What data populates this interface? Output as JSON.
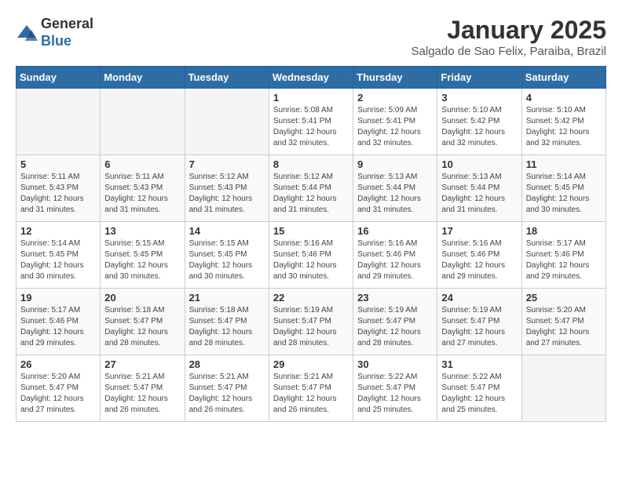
{
  "header": {
    "logo_line1": "General",
    "logo_line2": "Blue",
    "month_year": "January 2025",
    "location": "Salgado de Sao Felix, Paraiba, Brazil"
  },
  "weekdays": [
    "Sunday",
    "Monday",
    "Tuesday",
    "Wednesday",
    "Thursday",
    "Friday",
    "Saturday"
  ],
  "weeks": [
    [
      {
        "day": "",
        "info": ""
      },
      {
        "day": "",
        "info": ""
      },
      {
        "day": "",
        "info": ""
      },
      {
        "day": "1",
        "info": "Sunrise: 5:08 AM\nSunset: 5:41 PM\nDaylight: 12 hours\nand 32 minutes."
      },
      {
        "day": "2",
        "info": "Sunrise: 5:09 AM\nSunset: 5:41 PM\nDaylight: 12 hours\nand 32 minutes."
      },
      {
        "day": "3",
        "info": "Sunrise: 5:10 AM\nSunset: 5:42 PM\nDaylight: 12 hours\nand 32 minutes."
      },
      {
        "day": "4",
        "info": "Sunrise: 5:10 AM\nSunset: 5:42 PM\nDaylight: 12 hours\nand 32 minutes."
      }
    ],
    [
      {
        "day": "5",
        "info": "Sunrise: 5:11 AM\nSunset: 5:43 PM\nDaylight: 12 hours\nand 31 minutes."
      },
      {
        "day": "6",
        "info": "Sunrise: 5:11 AM\nSunset: 5:43 PM\nDaylight: 12 hours\nand 31 minutes."
      },
      {
        "day": "7",
        "info": "Sunrise: 5:12 AM\nSunset: 5:43 PM\nDaylight: 12 hours\nand 31 minutes."
      },
      {
        "day": "8",
        "info": "Sunrise: 5:12 AM\nSunset: 5:44 PM\nDaylight: 12 hours\nand 31 minutes."
      },
      {
        "day": "9",
        "info": "Sunrise: 5:13 AM\nSunset: 5:44 PM\nDaylight: 12 hours\nand 31 minutes."
      },
      {
        "day": "10",
        "info": "Sunrise: 5:13 AM\nSunset: 5:44 PM\nDaylight: 12 hours\nand 31 minutes."
      },
      {
        "day": "11",
        "info": "Sunrise: 5:14 AM\nSunset: 5:45 PM\nDaylight: 12 hours\nand 30 minutes."
      }
    ],
    [
      {
        "day": "12",
        "info": "Sunrise: 5:14 AM\nSunset: 5:45 PM\nDaylight: 12 hours\nand 30 minutes."
      },
      {
        "day": "13",
        "info": "Sunrise: 5:15 AM\nSunset: 5:45 PM\nDaylight: 12 hours\nand 30 minutes."
      },
      {
        "day": "14",
        "info": "Sunrise: 5:15 AM\nSunset: 5:45 PM\nDaylight: 12 hours\nand 30 minutes."
      },
      {
        "day": "15",
        "info": "Sunrise: 5:16 AM\nSunset: 5:46 PM\nDaylight: 12 hours\nand 30 minutes."
      },
      {
        "day": "16",
        "info": "Sunrise: 5:16 AM\nSunset: 5:46 PM\nDaylight: 12 hours\nand 29 minutes."
      },
      {
        "day": "17",
        "info": "Sunrise: 5:16 AM\nSunset: 5:46 PM\nDaylight: 12 hours\nand 29 minutes."
      },
      {
        "day": "18",
        "info": "Sunrise: 5:17 AM\nSunset: 5:46 PM\nDaylight: 12 hours\nand 29 minutes."
      }
    ],
    [
      {
        "day": "19",
        "info": "Sunrise: 5:17 AM\nSunset: 5:46 PM\nDaylight: 12 hours\nand 29 minutes."
      },
      {
        "day": "20",
        "info": "Sunrise: 5:18 AM\nSunset: 5:47 PM\nDaylight: 12 hours\nand 28 minutes."
      },
      {
        "day": "21",
        "info": "Sunrise: 5:18 AM\nSunset: 5:47 PM\nDaylight: 12 hours\nand 28 minutes."
      },
      {
        "day": "22",
        "info": "Sunrise: 5:19 AM\nSunset: 5:47 PM\nDaylight: 12 hours\nand 28 minutes."
      },
      {
        "day": "23",
        "info": "Sunrise: 5:19 AM\nSunset: 5:47 PM\nDaylight: 12 hours\nand 28 minutes."
      },
      {
        "day": "24",
        "info": "Sunrise: 5:19 AM\nSunset: 5:47 PM\nDaylight: 12 hours\nand 27 minutes."
      },
      {
        "day": "25",
        "info": "Sunrise: 5:20 AM\nSunset: 5:47 PM\nDaylight: 12 hours\nand 27 minutes."
      }
    ],
    [
      {
        "day": "26",
        "info": "Sunrise: 5:20 AM\nSunset: 5:47 PM\nDaylight: 12 hours\nand 27 minutes."
      },
      {
        "day": "27",
        "info": "Sunrise: 5:21 AM\nSunset: 5:47 PM\nDaylight: 12 hours\nand 26 minutes."
      },
      {
        "day": "28",
        "info": "Sunrise: 5:21 AM\nSunset: 5:47 PM\nDaylight: 12 hours\nand 26 minutes."
      },
      {
        "day": "29",
        "info": "Sunrise: 5:21 AM\nSunset: 5:47 PM\nDaylight: 12 hours\nand 26 minutes."
      },
      {
        "day": "30",
        "info": "Sunrise: 5:22 AM\nSunset: 5:47 PM\nDaylight: 12 hours\nand 25 minutes."
      },
      {
        "day": "31",
        "info": "Sunrise: 5:22 AM\nSunset: 5:47 PM\nDaylight: 12 hours\nand 25 minutes."
      },
      {
        "day": "",
        "info": ""
      }
    ]
  ]
}
